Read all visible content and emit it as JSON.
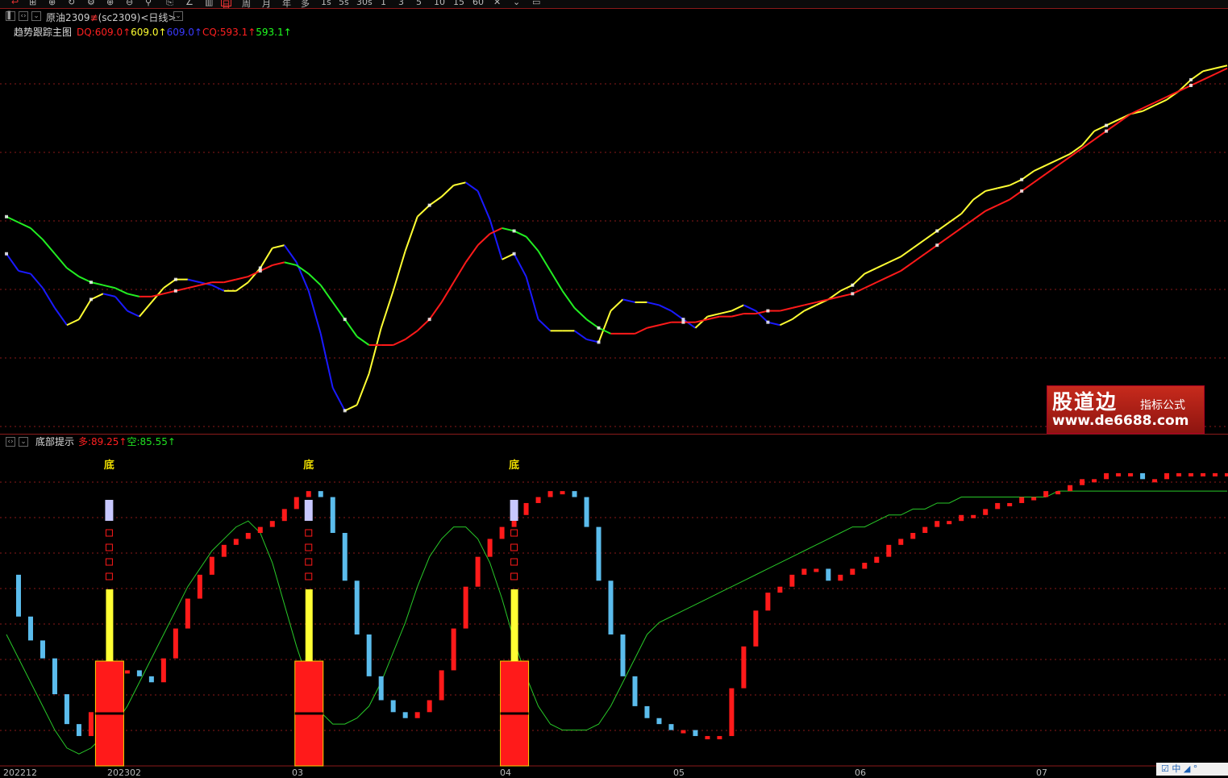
{
  "toolbar": {
    "items": [
      "周",
      "月",
      "年",
      "多",
      "1s",
      "5s",
      "30s",
      "1",
      "3",
      "5",
      "10",
      "15",
      "60"
    ]
  },
  "header": {
    "name": "原油2309",
    "flag": "≢",
    "code": "(sc2309)",
    "period": "<日线>"
  },
  "top_pane": {
    "title": "趋势跟踪主图",
    "readouts": [
      {
        "text": "DQ:609.0↑",
        "color": "#ff2020"
      },
      {
        "text": "609.0↑",
        "color": "#ffff30"
      },
      {
        "text": "609.0↑",
        "color": "#2020ff"
      },
      {
        "text": "CQ:593.1↑",
        "color": "#ff2020"
      },
      {
        "text": "593.1↑",
        "color": "#20ff20"
      }
    ]
  },
  "bottom_pane": {
    "title": "底部提示",
    "readouts": [
      {
        "text": "多:89.25↑",
        "color": "#ff2020"
      },
      {
        "text": "空:85.55↑",
        "color": "#20e020"
      }
    ],
    "signal_label": "底"
  },
  "watermark": {
    "name": "股道边",
    "tag": "指标公式",
    "url": "www.de6688.com"
  },
  "x_axis_labels": [
    "202212",
    "202302",
    "03",
    "04",
    "05",
    "06",
    "07"
  ],
  "corner_widget": "☑ 中 ◢ °",
  "colors": {
    "up": "#ff1a1a",
    "down": "#5bbcec",
    "yellow": "#ffff33",
    "blue": "#1a1aff",
    "green": "#22ee22",
    "grid": "#8b1a1a"
  },
  "chart_data": [
    {
      "type": "line",
      "title": "趋势跟踪主图",
      "x": [
        0,
        2,
        4,
        6,
        8,
        10,
        12,
        14,
        16,
        18,
        20,
        22,
        24,
        26,
        28,
        30,
        32,
        34,
        36,
        38,
        40,
        42,
        44,
        46,
        48,
        50,
        52,
        54,
        56,
        58,
        60,
        62,
        64,
        66,
        68,
        70,
        72,
        74,
        76,
        78,
        80,
        82,
        84,
        86,
        88,
        90,
        92,
        94,
        96,
        98,
        100,
        102,
        104,
        106,
        108,
        110,
        112,
        114,
        116,
        118,
        120,
        122,
        124,
        126,
        128,
        130,
        132,
        134,
        136,
        138,
        140,
        142,
        144,
        146,
        148,
        150,
        152,
        154,
        156,
        158,
        160,
        162,
        164,
        166,
        168,
        170,
        172,
        174,
        176,
        178,
        180,
        182,
        184,
        186,
        188,
        190,
        192,
        194,
        196,
        198,
        200,
        202
      ],
      "series": [
        {
          "name": "DQ",
          "values": [
            583,
            577,
            576,
            571,
            564,
            558,
            560,
            567,
            569,
            568,
            563,
            561,
            566,
            571,
            574,
            574,
            573,
            572,
            570,
            570,
            573,
            578,
            585,
            586,
            580,
            570,
            555,
            536,
            528,
            530,
            541,
            557,
            570,
            584,
            596,
            600,
            603,
            607,
            608,
            605,
            595,
            581,
            583,
            575,
            560,
            556,
            556,
            556,
            553,
            552,
            563,
            567,
            566,
            566,
            565,
            563,
            560,
            557,
            561,
            562,
            563,
            565,
            563,
            559,
            558,
            560,
            563,
            565,
            567,
            570,
            572,
            576,
            578,
            580,
            582,
            585,
            588,
            591,
            594,
            597,
            602,
            605,
            606,
            607,
            609,
            612,
            614,
            616,
            618,
            621,
            626,
            628,
            630,
            632,
            633,
            635,
            637,
            640,
            644,
            647,
            648,
            649
          ]
        },
        {
          "name": "CQ",
          "values": [
            596,
            594,
            592,
            588,
            583,
            578,
            575,
            573,
            572,
            571,
            569,
            568,
            568,
            569,
            570,
            571,
            572,
            573,
            573,
            574,
            575,
            577,
            579,
            580,
            579,
            576,
            572,
            566,
            560,
            554,
            551,
            551,
            551,
            553,
            556,
            560,
            566,
            573,
            580,
            586,
            590,
            592,
            591,
            589,
            584,
            577,
            570,
            564,
            560,
            557,
            555,
            555,
            555,
            557,
            558,
            559,
            559,
            559,
            560,
            561,
            561,
            562,
            562,
            563,
            563,
            564,
            565,
            566,
            567,
            568,
            569,
            571,
            573,
            575,
            577,
            580,
            583,
            586,
            589,
            592,
            595,
            598,
            600,
            602,
            605,
            608,
            611,
            614,
            617,
            620,
            623,
            626,
            629,
            632,
            634,
            636,
            638,
            640,
            642,
            644,
            646,
            648
          ]
        }
      ],
      "xlabel": "",
      "ylabel": ""
    },
    {
      "type": "bar",
      "title": "底部提示",
      "x": [
        0,
        2,
        4,
        6,
        8,
        10,
        12,
        14,
        16,
        18,
        20,
        22,
        24,
        26,
        28,
        30,
        32,
        34,
        36,
        38,
        40,
        42,
        44,
        46,
        48,
        50,
        52,
        54,
        56,
        58,
        60,
        62,
        64,
        66,
        68,
        70,
        72,
        74,
        76,
        78,
        80,
        82,
        84,
        86,
        88,
        90,
        92,
        94,
        96,
        98,
        100,
        102,
        104,
        106,
        108,
        110,
        112,
        114,
        116,
        118,
        120,
        122,
        124,
        126,
        128,
        130,
        132,
        134,
        136,
        138,
        140,
        142,
        144,
        146,
        148,
        150,
        152,
        154,
        156,
        158,
        160,
        162,
        164,
        166,
        168,
        170,
        172,
        174,
        176,
        178,
        180,
        182,
        184,
        186,
        188,
        190,
        192,
        194,
        196,
        198,
        200,
        202
      ],
      "series": [
        {
          "name": "多",
          "values": [
            72,
            65,
            61,
            58,
            52,
            47,
            45,
            49,
            53,
            56,
            56,
            55,
            54,
            58,
            63,
            68,
            72,
            75,
            77,
            78,
            79,
            80,
            81,
            83,
            85,
            86,
            85,
            79,
            71,
            62,
            55,
            51,
            49,
            48,
            49,
            51,
            56,
            63,
            70,
            75,
            78,
            80,
            82,
            84,
            85,
            86,
            86,
            85,
            80,
            71,
            62,
            55,
            50,
            48,
            47,
            46,
            46,
            45,
            45,
            45,
            53,
            60,
            66,
            69,
            70,
            72,
            73,
            73,
            71,
            72,
            73,
            74,
            75,
            77,
            78,
            79,
            80,
            81,
            81,
            82,
            82,
            83,
            84,
            84,
            85,
            85,
            86,
            86,
            87,
            88,
            88,
            89,
            89,
            89,
            88,
            88,
            89,
            89,
            89,
            89,
            89,
            89
          ]
        },
        {
          "name": "空",
          "values": [
            62,
            58,
            54,
            50,
            46,
            43,
            42,
            43,
            45,
            47,
            50,
            54,
            58,
            62,
            66,
            70,
            73,
            76,
            78,
            80,
            81,
            79,
            74,
            67,
            60,
            54,
            49,
            47,
            47,
            48,
            50,
            54,
            59,
            64,
            70,
            75,
            78,
            80,
            80,
            78,
            74,
            68,
            61,
            55,
            50,
            47,
            46,
            46,
            46,
            47,
            50,
            54,
            58,
            62,
            64,
            65,
            66,
            67,
            68,
            69,
            70,
            71,
            72,
            73,
            74,
            75,
            76,
            77,
            78,
            79,
            80,
            80,
            81,
            82,
            82,
            83,
            83,
            84,
            84,
            85,
            85,
            85,
            85,
            85,
            85,
            85,
            85,
            86,
            86,
            86,
            86,
            86,
            86,
            86,
            86,
            86,
            86,
            86,
            86,
            86,
            86,
            86
          ]
        }
      ],
      "signals": [
        {
          "label": "底",
          "x": 17
        },
        {
          "label": "底",
          "x": 50
        },
        {
          "label": "底",
          "x": 84
        }
      ],
      "xlabel": "",
      "ylabel": ""
    }
  ]
}
